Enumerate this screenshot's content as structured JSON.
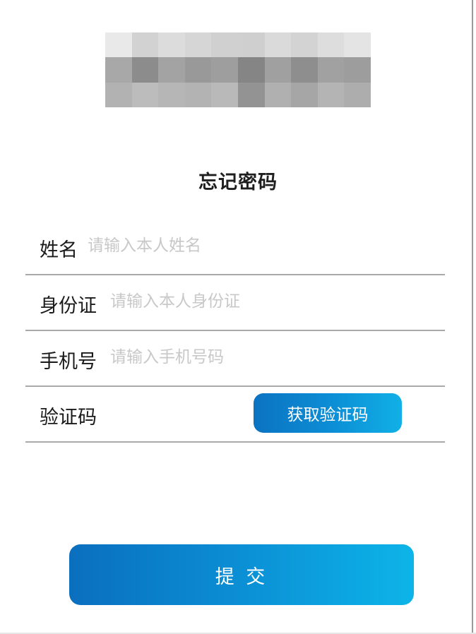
{
  "header": {
    "logo": "pixelated-logo",
    "title": "忘记密码"
  },
  "form": {
    "name_row": {
      "label": "姓名",
      "placeholder": "请输入本人姓名",
      "value": ""
    },
    "id_row": {
      "label": "身份证",
      "placeholder": "请输入本人身份证",
      "value": ""
    },
    "phone_row": {
      "label": "手机号",
      "placeholder": "请输入手机号码",
      "value": ""
    },
    "code_row": {
      "label": "验证码",
      "value": "",
      "get_code_label": "获取验证码"
    }
  },
  "actions": {
    "submit_label": "提 交"
  },
  "colors": {
    "accent_start": "#0a6fbe",
    "accent_end": "#0db4e8",
    "divider": "#a9a9a9",
    "placeholder": "#c8c8c8"
  }
}
